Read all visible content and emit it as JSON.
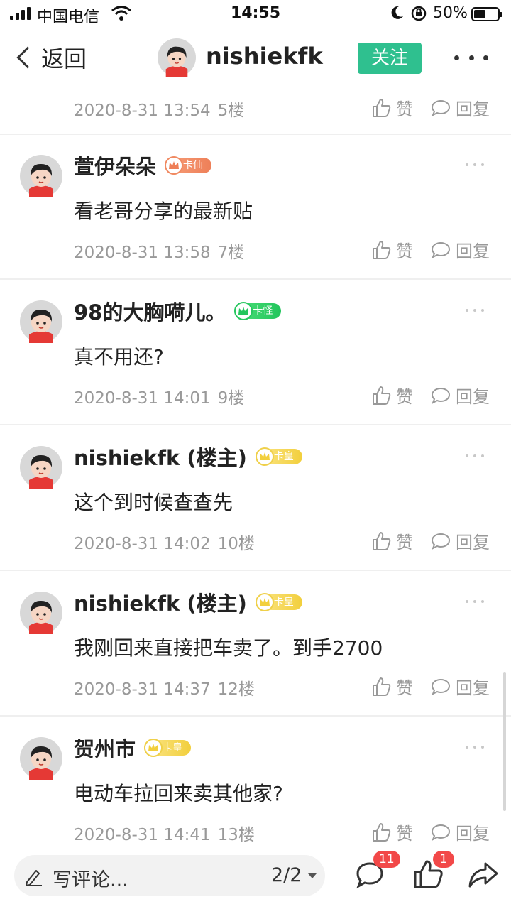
{
  "status_bar": {
    "carrier": "中国电信",
    "time": "14:55",
    "battery": "50%"
  },
  "nav": {
    "back_label": "返回",
    "username": "nishiekfk",
    "follow_label": "关注"
  },
  "top_meta": {
    "date": "2020-8-31 13:54",
    "floor": "5楼",
    "like_label": "赞",
    "reply_label": "回复"
  },
  "comments": [
    {
      "name": "萱伊朵朵",
      "badge": "卡仙",
      "badge_color": "#ee7f58",
      "text": "看老哥分享的最新贴",
      "date": "2020-8-31 13:58",
      "floor": "7楼",
      "like_label": "赞",
      "reply_label": "回复"
    },
    {
      "name": "98的大胸嗬儿。",
      "badge": "卡怪",
      "badge_color": "#22c55c",
      "text": "真不用还?",
      "date": "2020-8-31 14:01",
      "floor": "9楼",
      "like_label": "赞",
      "reply_label": "回复"
    },
    {
      "name": "nishiekfk (楼主)",
      "badge": "卡皇",
      "badge_color": "#f2cf3c",
      "text": "这个到时候查查先",
      "date": "2020-8-31 14:02",
      "floor": "10楼",
      "like_label": "赞",
      "reply_label": "回复"
    },
    {
      "name": "nishiekfk (楼主)",
      "badge": "卡皇",
      "badge_color": "#f2cf3c",
      "text": "我刚回来直接把车卖了。到手2700",
      "date": "2020-8-31 14:37",
      "floor": "12楼",
      "like_label": "赞",
      "reply_label": "回复"
    },
    {
      "name": "贺州市",
      "badge": "卡皇",
      "badge_color": "#f2cf3c",
      "text": "电动车拉回来卖其他家?",
      "date": "2020-8-31 14:41",
      "floor": "13楼",
      "like_label": "赞",
      "reply_label": "回复"
    }
  ],
  "bottom_bar": {
    "placeholder": "写评论...",
    "page": "2/2",
    "comment_count": "11",
    "like_count": "1"
  },
  "colors": {
    "accent": "#2fc08f",
    "badge_red": "#f24848",
    "meta_gray": "#999999"
  },
  "icons": [
    "signal-icon",
    "wifi-icon",
    "moon-icon",
    "rotation-lock-icon",
    "battery-icon",
    "chevron-left-icon",
    "more-icon",
    "thumb-up-icon",
    "chat-bubble-icon",
    "pencil-icon",
    "caret-down-icon",
    "share-icon",
    "crown-icon"
  ]
}
